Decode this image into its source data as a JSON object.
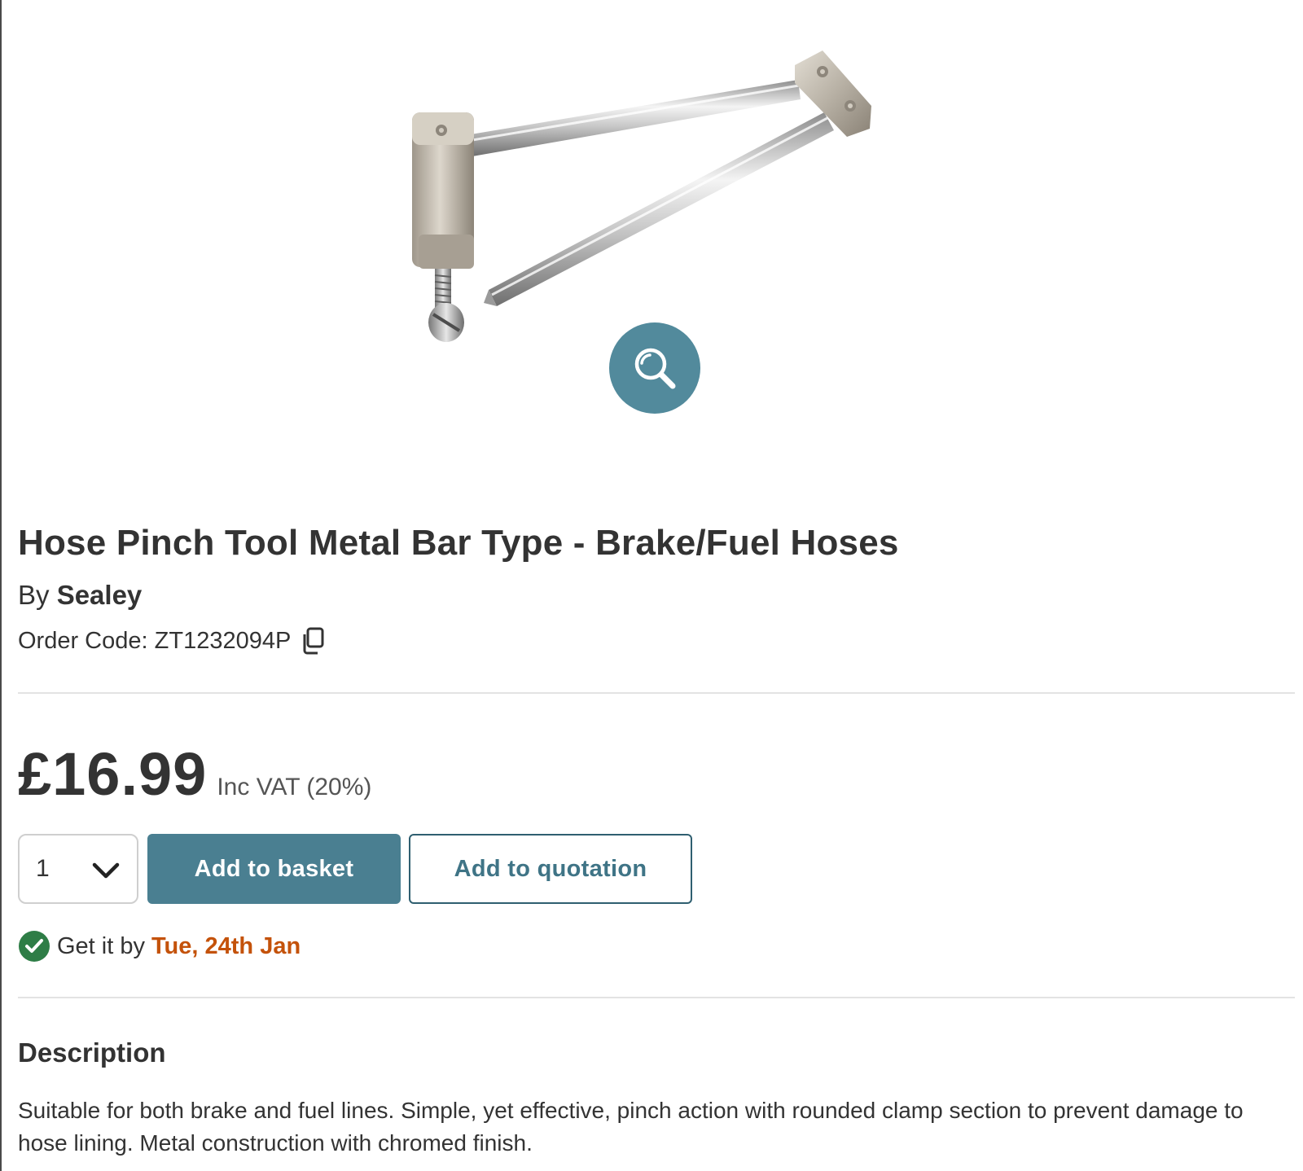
{
  "product": {
    "image_alt": "Hose Pinch Tool Metal Bar Type",
    "title": "Hose Pinch Tool Metal Bar Type - Brake/Fuel Hoses",
    "by_prefix": "By",
    "brand": "Sealey",
    "order_code_label": "Order Code:",
    "order_code": "ZT1232094P",
    "price": "£16.99",
    "vat_note": "Inc VAT (20%)"
  },
  "actions": {
    "quantity": "1",
    "add_to_basket": "Add to basket",
    "add_to_quotation": "Add to quotation"
  },
  "delivery": {
    "prefix": "Get it by",
    "date": "Tue, 24th Jan"
  },
  "description": {
    "heading": "Description",
    "body": "Suitable for both brake and fuel lines. Simple, yet effective, pinch action with rounded clamp section to prevent damage to hose lining. Metal construction with chromed finish."
  },
  "icons": {
    "zoom": "magnifier-icon",
    "copy": "copy-icon",
    "select_chevron": "chevron-down-icon",
    "delivery_check": "check-circle-icon"
  },
  "colors": {
    "primary": "#4a7f91",
    "zoom_button": "#528a9c",
    "delivery_date": "#c4520a",
    "check": "#2e7d46"
  }
}
